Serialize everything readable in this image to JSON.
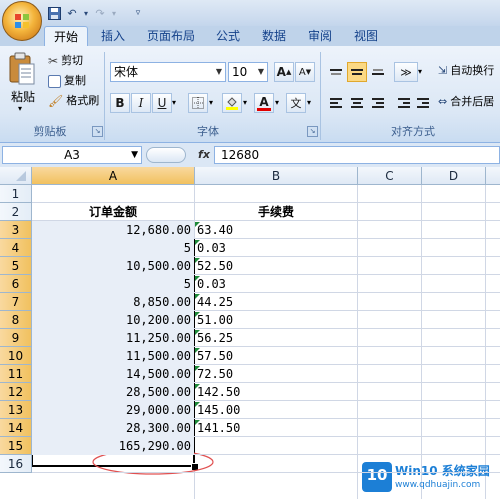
{
  "tabs": [
    "开始",
    "插入",
    "页面布局",
    "公式",
    "数据",
    "审阅",
    "视图"
  ],
  "active_tab": "开始",
  "clipboard": {
    "paste_label": "粘贴",
    "cut_label": "剪切",
    "copy_label": "复制",
    "format_painter_label": "格式刷",
    "group_label": "剪贴板"
  },
  "font": {
    "font_name": "宋体",
    "font_size": "10",
    "bold": "B",
    "italic": "I",
    "underline": "U",
    "font_color_letter": "A",
    "wen": "文",
    "group_label": "字体",
    "grow": "A",
    "shrink": "A"
  },
  "alignment": {
    "wrap_text_label": "自动换行",
    "merge_center_label": "合并后居",
    "group_label": "对齐方式"
  },
  "formula_bar": {
    "name_box": "A3",
    "fx": "fx",
    "value": "12680"
  },
  "columns": [
    "A",
    "B",
    "C",
    "D"
  ],
  "rows": [
    "1",
    "2",
    "3",
    "4",
    "5",
    "6",
    "7",
    "8",
    "9",
    "10",
    "11",
    "12",
    "13",
    "14",
    "15",
    "16"
  ],
  "headers": {
    "order_amount": "订单金额",
    "fee": "手续费"
  },
  "data_rows": [
    {
      "amount": "12,680.00",
      "fee": "63.40"
    },
    {
      "amount": "5",
      "fee": "0.03"
    },
    {
      "amount": "10,500.00",
      "fee": "52.50"
    },
    {
      "amount": "5",
      "fee": "0.03"
    },
    {
      "amount": "8,850.00",
      "fee": "44.25"
    },
    {
      "amount": "10,200.00",
      "fee": "51.00"
    },
    {
      "amount": "11,250.00",
      "fee": "56.25"
    },
    {
      "amount": "11,500.00",
      "fee": "57.50"
    },
    {
      "amount": "14,500.00",
      "fee": "72.50"
    },
    {
      "amount": "28,500.00",
      "fee": "142.50"
    },
    {
      "amount": "29,000.00",
      "fee": "145.00"
    },
    {
      "amount": "28,300.00",
      "fee": "141.50"
    }
  ],
  "total": "165,290.00",
  "watermark": {
    "logo": "10",
    "name": "Win10 系统家园",
    "url": "www.qdhuajin.com"
  },
  "colors": {
    "selection_border": "#000000",
    "selection_fill": "#e8eef7",
    "circle": "#e05050",
    "header_highlight": "#f1c15f"
  }
}
